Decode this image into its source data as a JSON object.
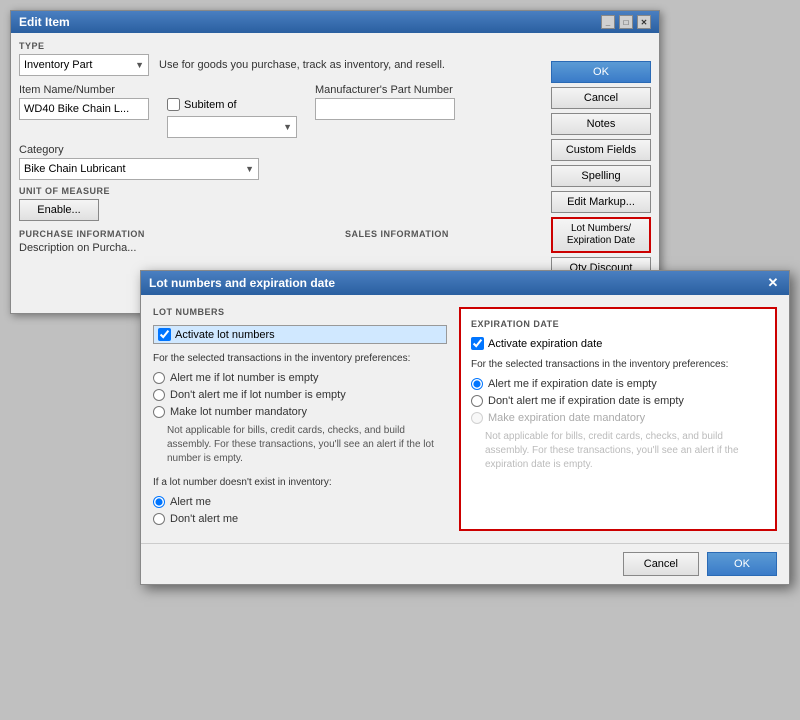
{
  "editItemWindow": {
    "title": "Edit Item",
    "type_label": "TYPE",
    "type_value": "Inventory Part",
    "type_description": "Use for goods you purchase, track as inventory, and resell.",
    "buttons": {
      "ok": "OK",
      "cancel": "Cancel",
      "notes": "Notes",
      "custom_fields": "Custom Fields",
      "spelling": "Spelling",
      "edit_markup": "Edit Markup...",
      "lot_numbers": "Lot Numbers/ Expiration Date",
      "qty_discount": "Qty Discount"
    },
    "item_name_label": "Item Name/Number",
    "item_name_value": "WD40 Bike Chain L...",
    "subitem_label": "Subitem of",
    "manufacturer_label": "Manufacturer's Part Number",
    "category_label": "Category",
    "category_value": "Bike Chain Lubricant",
    "unit_label": "UNIT OF MEASURE",
    "enable_btn": "Enable...",
    "purchase_label": "PURCHASE INFORMATION",
    "sales_label": "SALES INFORMATION",
    "purchase_desc_label": "Description on Purcha..."
  },
  "lotDialog": {
    "title": "Lot numbers and expiration date",
    "lot_section_title": "LOT NUMBERS",
    "activate_lot_label": "Activate lot numbers",
    "lot_prefs_text": "For the selected transactions in the inventory preferences:",
    "lot_radio1": "Alert me if lot number is empty",
    "lot_radio2": "Don't alert me if lot number is empty",
    "lot_radio3": "Make lot number mandatory",
    "lot_note": "Not applicable for bills, credit cards, checks, and build assembly. For these transactions, you'll see an alert if the lot number is empty.",
    "lot_exists_label": "If a lot number doesn't exist in inventory:",
    "lot_radio4": "Alert me",
    "lot_radio5": "Don't alert me",
    "expiration_section_title": "EXPIRATION DATE",
    "activate_exp_label": "Activate expiration date",
    "exp_prefs_text": "For the selected transactions in the inventory preferences:",
    "exp_radio1": "Alert me if expiration date is empty",
    "exp_radio2": "Don't alert me if expiration date is empty",
    "exp_radio3": "Make expiration date mandatory",
    "exp_note": "Not applicable for bills, credit cards, checks, and build assembly. For these transactions, you'll see an alert if the expiration date is empty.",
    "cancel_btn": "Cancel",
    "ok_btn": "OK",
    "close_x": "✕"
  }
}
